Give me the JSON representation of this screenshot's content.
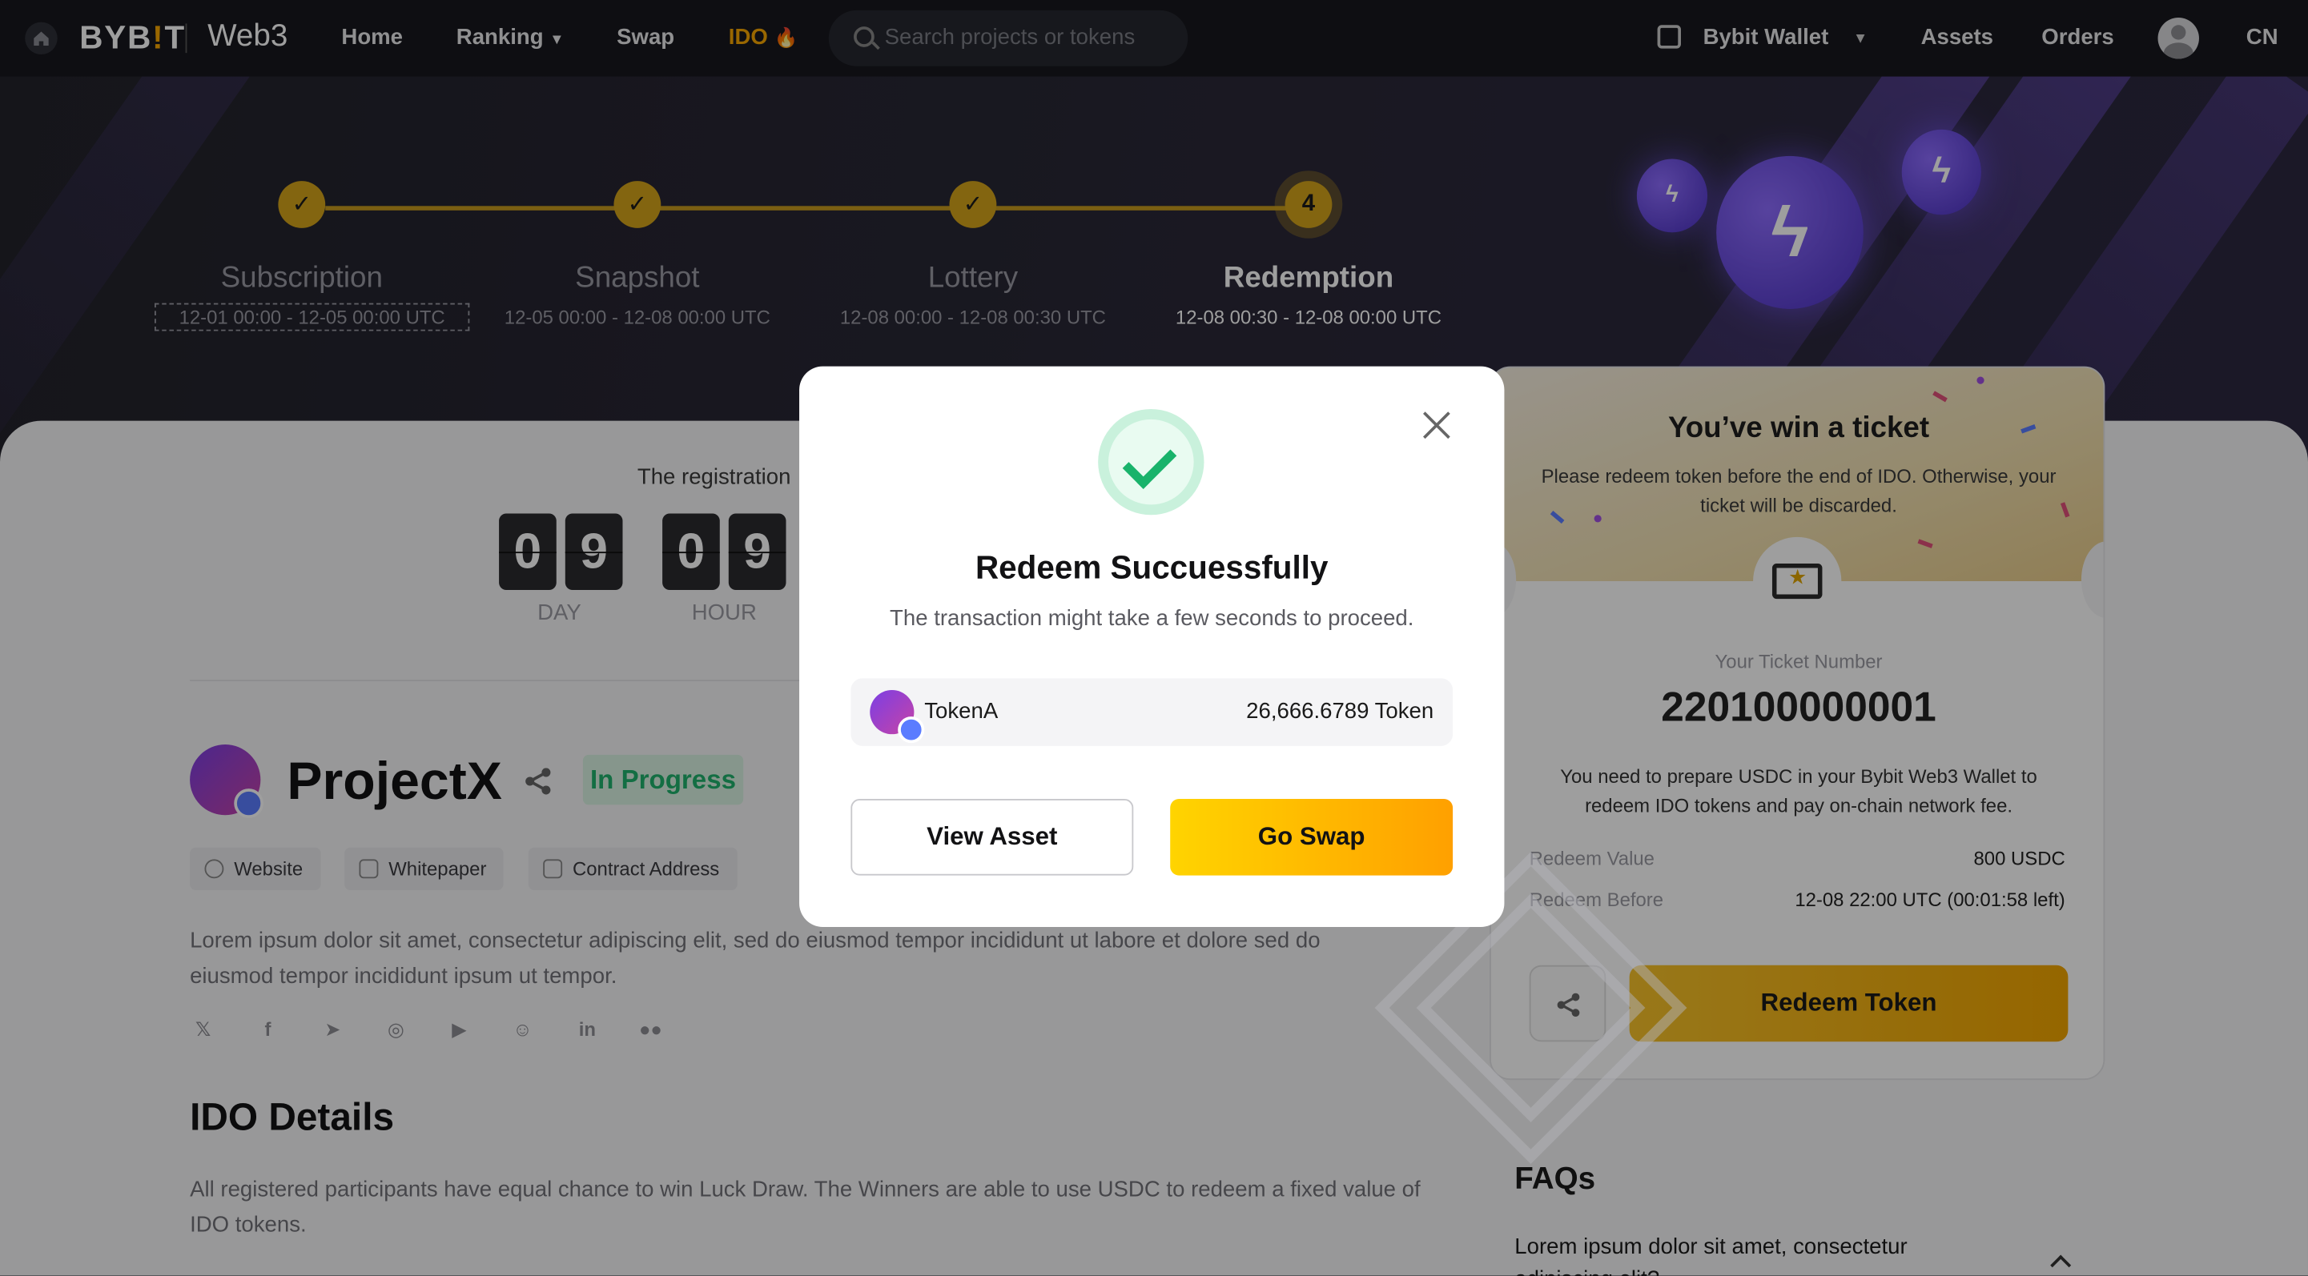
{
  "nav": {
    "logo": "BYB",
    "logo_i": "!",
    "logo_t": "T",
    "brand": "Web3",
    "links": [
      "Home",
      "Ranking",
      "Swap",
      "IDO"
    ],
    "search_placeholder": "Search projects or tokens",
    "wallet": "Bybit Wallet",
    "assets": "Assets",
    "orders": "Orders",
    "lang": "CN",
    "accent": "#f7a600"
  },
  "steps": [
    {
      "num": "1",
      "title": "Subscription",
      "date": "12-01 00:00 - 12-05 00:00 UTC"
    },
    {
      "num": "2",
      "title": "Snapshot",
      "date": "12-05 00:00 - 12-08 00:00 UTC"
    },
    {
      "num": "3",
      "title": "Lottery",
      "date": "12-08 00:00 - 12-08 00:30 UTC"
    },
    {
      "num": "4",
      "title": "Redemption",
      "date": "12-08 00:30 - 12-08 00:00 UTC"
    }
  ],
  "countdown": {
    "text": "The registration",
    "day": [
      "0",
      "9"
    ],
    "hour": [
      "0",
      "9"
    ],
    "day_label": "DAY",
    "hour_label": "HOUR"
  },
  "project": {
    "name": "ProjectX",
    "status": "In Progress",
    "links": [
      "Website",
      "Whitepaper",
      "Contract Address"
    ],
    "description": "Lorem ipsum dolor sit amet, consectetur adipiscing elit, sed do eiusmod tempor incididunt ut labore et dolore sed do eiusmod tempor incididunt ipsum ut tempor.",
    "socials": [
      "twitter-icon",
      "facebook-icon",
      "telegram-icon",
      "instagram-icon",
      "youtube-icon",
      "discord-icon",
      "linkedin-icon",
      "medium-icon"
    ]
  },
  "ido": {
    "title": "IDO Details",
    "description": "All registered participants have equal chance to win Luck Draw. The Winners are able to use USDC to redeem a fixed value of IDO tokens."
  },
  "ticket": {
    "title": "You’ve win a ticket",
    "subtitle": "Please redeem token before the end of IDO. Otherwise, your ticket will be discarded.",
    "number_label": "Your Ticket Number",
    "number": "220100000001",
    "note": "You need to prepare USDC in your Bybit Web3 Wallet to redeem IDO tokens and pay on-chain network fee.",
    "redeem_value_label": "Redeem Value",
    "redeem_value": "800 USDC",
    "redeem_before_label": "Redeem Before",
    "redeem_before": "12-08 22:00 UTC (00:01:58 left)",
    "redeem_button": "Redeem Token"
  },
  "faq": {
    "title": "FAQs",
    "question": "Lorem ipsum dolor sit amet, consectetur adipiscing elit?"
  },
  "modal": {
    "title": "Redeem Succuessfully",
    "subtitle": "The transaction might take a few seconds to proceed.",
    "token_name": "TokenA",
    "token_amount": "26,666.6789 Token",
    "view_button": "View Asset",
    "swap_button": "Go Swap"
  }
}
